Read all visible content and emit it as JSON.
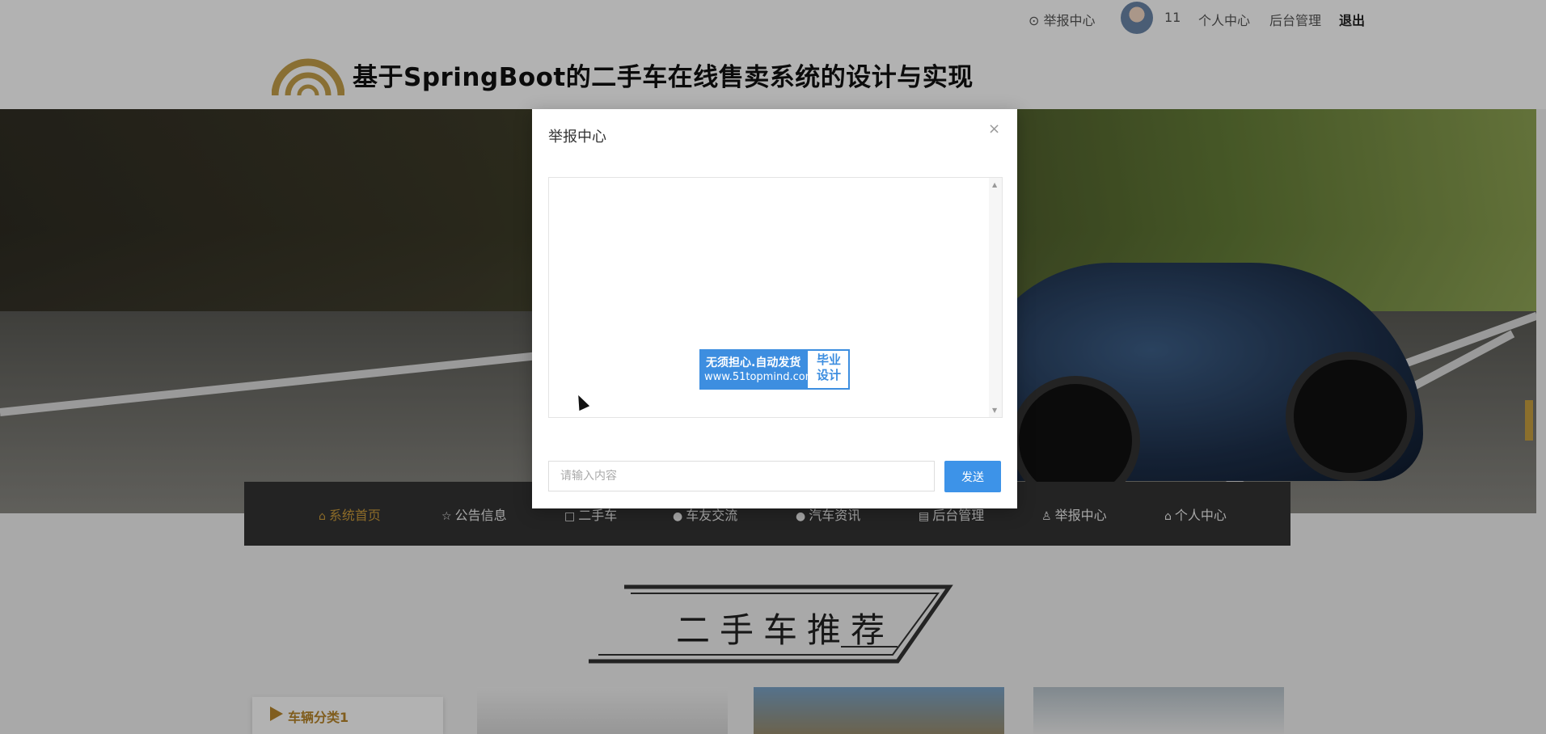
{
  "topbar": {
    "report_center": "举报中心",
    "username": "11",
    "personal_center": "个人中心",
    "admin": "后台管理",
    "logout": "退出"
  },
  "header": {
    "title": "基于SpringBoot的二手车在线售卖系统的设计与实现"
  },
  "nav": {
    "items": [
      {
        "label": "系统首页",
        "icon": "home-icon",
        "active": true
      },
      {
        "label": "公告信息",
        "icon": "star-icon"
      },
      {
        "label": "二手车",
        "icon": "bag-icon"
      },
      {
        "label": "车友交流",
        "icon": "info-icon"
      },
      {
        "label": "汽车资讯",
        "icon": "question-icon"
      },
      {
        "label": "后台管理",
        "icon": "document-icon"
      },
      {
        "label": "举报中心",
        "icon": "user-icon"
      },
      {
        "label": "个人中心",
        "icon": "home-icon"
      }
    ]
  },
  "section": {
    "title": "二手车推荐"
  },
  "category": {
    "label": "车辆分类1"
  },
  "dialog": {
    "title": "举报中心",
    "close": "×",
    "input_placeholder": "请输入内容",
    "send_label": "发送",
    "watermark": {
      "line1": "无须担心.自动发货",
      "line2": "www.51topmind.com",
      "right1": "毕业",
      "right2": "设计"
    }
  },
  "colors": {
    "accent": "#c99a3a",
    "nav_bg": "#333333",
    "send_button": "#3d93e8"
  }
}
